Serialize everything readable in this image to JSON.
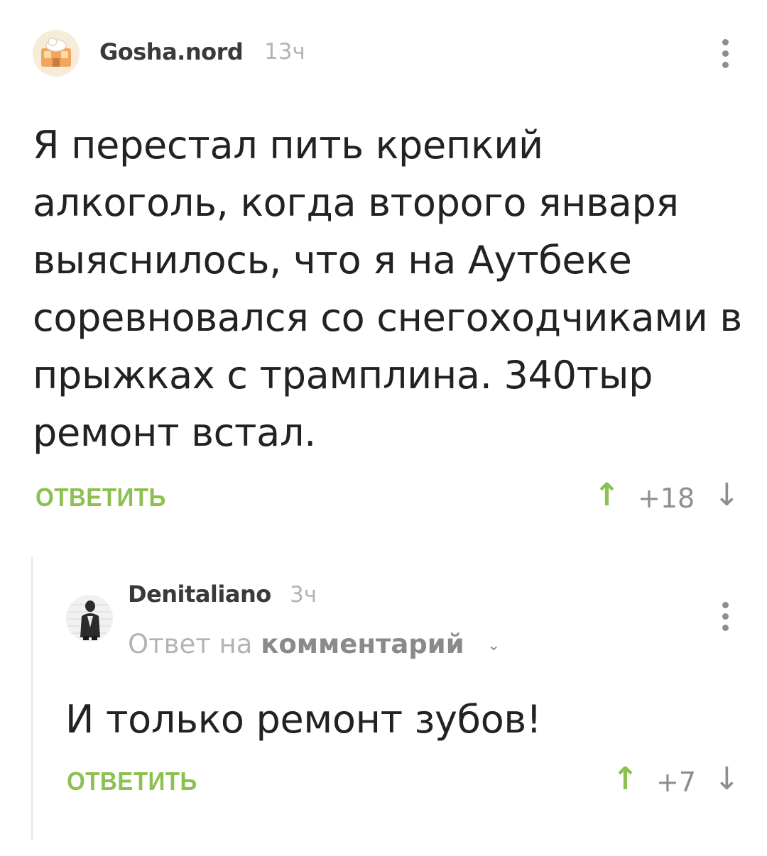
{
  "comment": {
    "username": "Gosha.nord",
    "time": "13ч",
    "text": "Я перестал пить крепкий алкоголь, когда второго января выяснилось, что я на Аутбеке соревновался со снегоходчиками в прыжках с трамплина. 340тыр ремонт встал.",
    "reply_label": "ОТВЕТИТЬ",
    "score": "+18",
    "up_icon": "arrow-up-icon",
    "down_icon": "arrow-down-icon"
  },
  "reply_comment": {
    "username": "Denitaliano",
    "time": "3ч",
    "answer_prefix": "Ответ на",
    "answer_target": "комментарий",
    "text": "И только ремонт зубов!",
    "reply_label": "ОТВЕТИТЬ",
    "score": "+7"
  },
  "glyphs": {
    "up": "↑",
    "down": "↓",
    "chevron": "⌄"
  },
  "colors": {
    "accent_green": "#8cc152",
    "muted": "#b3b3b3",
    "text": "#222222"
  }
}
